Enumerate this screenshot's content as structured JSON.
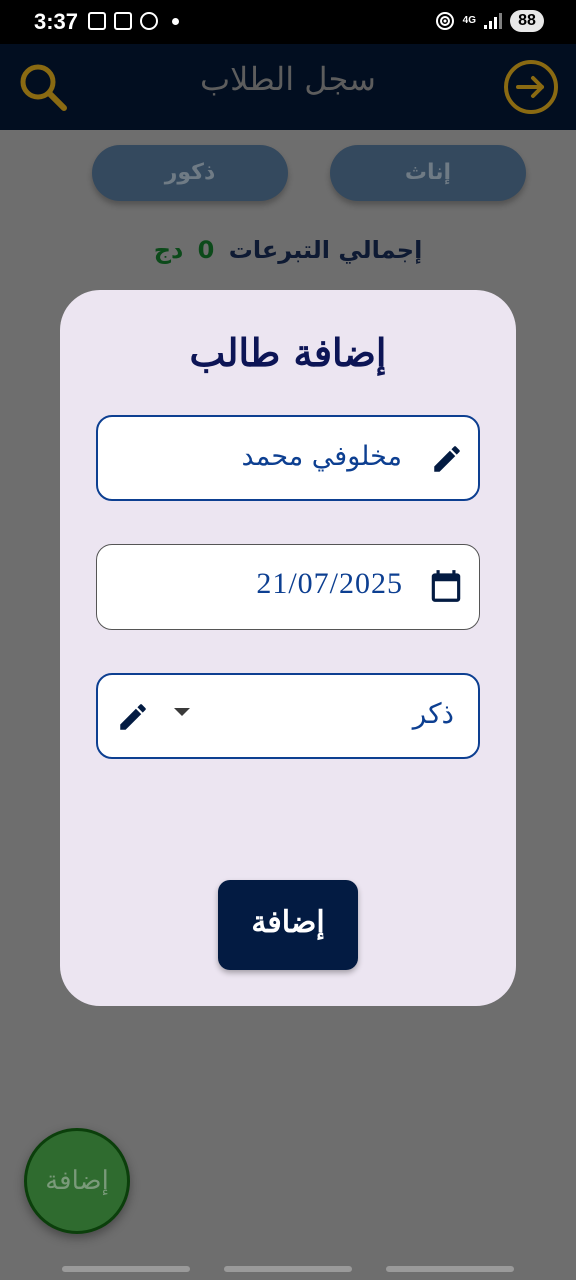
{
  "status_bar": {
    "time": "3:37",
    "network": "4G",
    "battery": "88"
  },
  "app_bar": {
    "title": "سجل الطلاب",
    "search_icon": "search-icon",
    "exit_icon": "exit-icon"
  },
  "filters": {
    "female_label": "إناث",
    "male_label": "ذكور"
  },
  "total": {
    "label": "إجمالي التبرعات",
    "value": "0",
    "currency": "دج"
  },
  "dialog": {
    "title": "إضافة طالب",
    "name_value": "مخلوفي محمد",
    "date_value": "21/07/2025",
    "gender_value": "ذكر",
    "submit_label": "إضافة"
  },
  "fab": {
    "label": "إضافة"
  },
  "colors": {
    "app_bar": "#020e20",
    "accent_gold": "#b68b1a",
    "dialog_bg": "#ece5f1",
    "primary_blue": "#0d3f91",
    "submit_bg": "#031b42",
    "fab_green": "#2f6b2f"
  }
}
